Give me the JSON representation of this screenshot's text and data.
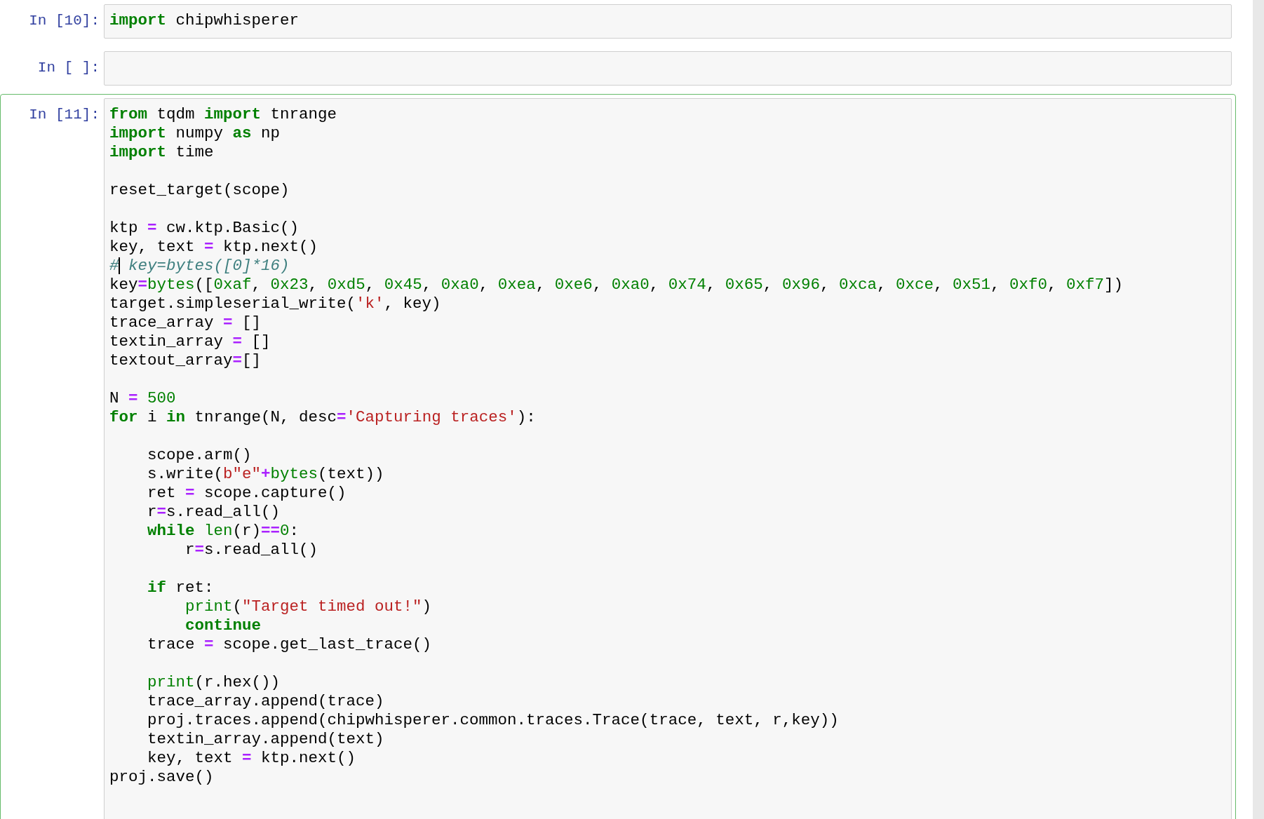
{
  "cells": [
    {
      "prompt": "In [10]:",
      "selected": false,
      "lines": [
        {
          "kind": "code",
          "tokens": [
            {
              "kind": "keyword",
              "text": "import"
            },
            {
              "kind": "plain",
              "text": " chipwhisperer"
            }
          ]
        }
      ]
    },
    {
      "prompt": "In [ ]:",
      "selected": false
    },
    {
      "prompt": "In [11]:",
      "selected": true,
      "lines": [
        {
          "kind": "code",
          "tokens": [
            {
              "kind": "keyword",
              "text": "from"
            },
            {
              "kind": "plain",
              "text": " tqdm "
            },
            {
              "kind": "keyword",
              "text": "import"
            },
            {
              "kind": "plain",
              "text": " tnrange"
            }
          ]
        },
        {
          "kind": "code",
          "tokens": [
            {
              "kind": "keyword",
              "text": "import"
            },
            {
              "kind": "plain",
              "text": " numpy "
            },
            {
              "kind": "keyword",
              "text": "as"
            },
            {
              "kind": "plain",
              "text": " np"
            }
          ]
        },
        {
          "kind": "code",
          "tokens": [
            {
              "kind": "keyword",
              "text": "import"
            },
            {
              "kind": "plain",
              "text": " time"
            }
          ]
        },
        {
          "kind": "blank"
        },
        {
          "kind": "code",
          "tokens": [
            {
              "kind": "plain",
              "text": "reset_target(scope)"
            }
          ]
        },
        {
          "kind": "blank"
        },
        {
          "kind": "code",
          "tokens": [
            {
              "kind": "plain",
              "text": "ktp "
            },
            {
              "kind": "operator",
              "text": "="
            },
            {
              "kind": "plain",
              "text": " cw.ktp.Basic()"
            }
          ]
        },
        {
          "kind": "code",
          "tokens": [
            {
              "kind": "plain",
              "text": "key, text "
            },
            {
              "kind": "operator",
              "text": "="
            },
            {
              "kind": "plain",
              "text": " ktp.next()"
            }
          ]
        },
        {
          "kind": "code",
          "tokens": [
            {
              "kind": "comment",
              "text": "#"
            },
            {
              "kind": "cursor"
            },
            {
              "kind": "comment",
              "text": " key=bytes([0]*16)"
            }
          ]
        },
        {
          "kind": "code",
          "tokens": [
            {
              "kind": "plain",
              "text": "key"
            },
            {
              "kind": "operator",
              "text": "="
            },
            {
              "kind": "builtin",
              "text": "bytes"
            },
            {
              "kind": "plain",
              "text": "(["
            },
            {
              "kind": "number",
              "text": "0xaf"
            },
            {
              "kind": "plain",
              "text": ", "
            },
            {
              "kind": "number",
              "text": "0x23"
            },
            {
              "kind": "plain",
              "text": ", "
            },
            {
              "kind": "number",
              "text": "0xd5"
            },
            {
              "kind": "plain",
              "text": ", "
            },
            {
              "kind": "number",
              "text": "0x45"
            },
            {
              "kind": "plain",
              "text": ", "
            },
            {
              "kind": "number",
              "text": "0xa0"
            },
            {
              "kind": "plain",
              "text": ", "
            },
            {
              "kind": "number",
              "text": "0xea"
            },
            {
              "kind": "plain",
              "text": ", "
            },
            {
              "kind": "number",
              "text": "0xe6"
            },
            {
              "kind": "plain",
              "text": ", "
            },
            {
              "kind": "number",
              "text": "0xa0"
            },
            {
              "kind": "plain",
              "text": ", "
            },
            {
              "kind": "number",
              "text": "0x74"
            },
            {
              "kind": "plain",
              "text": ", "
            },
            {
              "kind": "number",
              "text": "0x65"
            },
            {
              "kind": "plain",
              "text": ", "
            },
            {
              "kind": "number",
              "text": "0x96"
            },
            {
              "kind": "plain",
              "text": ", "
            },
            {
              "kind": "number",
              "text": "0xca"
            },
            {
              "kind": "plain",
              "text": ", "
            },
            {
              "kind": "number",
              "text": "0xce"
            },
            {
              "kind": "plain",
              "text": ", "
            },
            {
              "kind": "number",
              "text": "0x51"
            },
            {
              "kind": "plain",
              "text": ", "
            },
            {
              "kind": "number",
              "text": "0xf0"
            },
            {
              "kind": "plain",
              "text": ", "
            },
            {
              "kind": "number",
              "text": "0xf7"
            },
            {
              "kind": "plain",
              "text": "])"
            }
          ]
        },
        {
          "kind": "code",
          "tokens": [
            {
              "kind": "plain",
              "text": "target.simpleserial_write("
            },
            {
              "kind": "string",
              "text": "'k'"
            },
            {
              "kind": "plain",
              "text": ", key)"
            }
          ]
        },
        {
          "kind": "code",
          "tokens": [
            {
              "kind": "plain",
              "text": "trace_array "
            },
            {
              "kind": "operator",
              "text": "="
            },
            {
              "kind": "plain",
              "text": " []"
            }
          ]
        },
        {
          "kind": "code",
          "tokens": [
            {
              "kind": "plain",
              "text": "textin_array "
            },
            {
              "kind": "operator",
              "text": "="
            },
            {
              "kind": "plain",
              "text": " []"
            }
          ]
        },
        {
          "kind": "code",
          "tokens": [
            {
              "kind": "plain",
              "text": "textout_array"
            },
            {
              "kind": "operator",
              "text": "="
            },
            {
              "kind": "plain",
              "text": "[]"
            }
          ]
        },
        {
          "kind": "blank"
        },
        {
          "kind": "code",
          "tokens": [
            {
              "kind": "plain",
              "text": "N "
            },
            {
              "kind": "operator",
              "text": "="
            },
            {
              "kind": "number",
              "text": " 500"
            }
          ]
        },
        {
          "kind": "code",
          "tokens": [
            {
              "kind": "keyword",
              "text": "for"
            },
            {
              "kind": "plain",
              "text": " i "
            },
            {
              "kind": "keyword",
              "text": "in"
            },
            {
              "kind": "plain",
              "text": " tnrange(N, desc"
            },
            {
              "kind": "operator",
              "text": "="
            },
            {
              "kind": "string",
              "text": "'Capturing traces'"
            },
            {
              "kind": "plain",
              "text": "):"
            }
          ]
        },
        {
          "kind": "blank"
        },
        {
          "kind": "code",
          "tokens": [
            {
              "kind": "plain",
              "text": "    scope.arm()"
            }
          ]
        },
        {
          "kind": "code",
          "tokens": [
            {
              "kind": "plain",
              "text": "    s.write("
            },
            {
              "kind": "string",
              "text": "b\"e\""
            },
            {
              "kind": "operator",
              "text": "+"
            },
            {
              "kind": "builtin",
              "text": "bytes"
            },
            {
              "kind": "plain",
              "text": "(text))"
            }
          ]
        },
        {
          "kind": "code",
          "tokens": [
            {
              "kind": "plain",
              "text": "    ret "
            },
            {
              "kind": "operator",
              "text": "="
            },
            {
              "kind": "plain",
              "text": " scope.capture()"
            }
          ]
        },
        {
          "kind": "code",
          "tokens": [
            {
              "kind": "plain",
              "text": "    r"
            },
            {
              "kind": "operator",
              "text": "="
            },
            {
              "kind": "plain",
              "text": "s.read_all()"
            }
          ]
        },
        {
          "kind": "code",
          "tokens": [
            {
              "kind": "keyword",
              "text": "    while"
            },
            {
              "kind": "builtin",
              "text": " len"
            },
            {
              "kind": "plain",
              "text": "(r)"
            },
            {
              "kind": "operator",
              "text": "=="
            },
            {
              "kind": "number",
              "text": "0"
            },
            {
              "kind": "plain",
              "text": ":"
            }
          ]
        },
        {
          "kind": "code",
          "tokens": [
            {
              "kind": "plain",
              "text": "        r"
            },
            {
              "kind": "operator",
              "text": "="
            },
            {
              "kind": "plain",
              "text": "s.read_all()"
            }
          ]
        },
        {
          "kind": "blank"
        },
        {
          "kind": "code",
          "tokens": [
            {
              "kind": "keyword",
              "text": "    if"
            },
            {
              "kind": "plain",
              "text": " ret:"
            }
          ]
        },
        {
          "kind": "code",
          "tokens": [
            {
              "kind": "builtin",
              "text": "        print"
            },
            {
              "kind": "plain",
              "text": "("
            },
            {
              "kind": "string",
              "text": "\"Target timed out!\""
            },
            {
              "kind": "plain",
              "text": ")"
            }
          ]
        },
        {
          "kind": "code",
          "tokens": [
            {
              "kind": "keyword",
              "text": "        continue"
            }
          ]
        },
        {
          "kind": "code",
          "tokens": [
            {
              "kind": "plain",
              "text": "    trace "
            },
            {
              "kind": "operator",
              "text": "="
            },
            {
              "kind": "plain",
              "text": " scope.get_last_trace()"
            }
          ]
        },
        {
          "kind": "blank"
        },
        {
          "kind": "code",
          "tokens": [
            {
              "kind": "builtin",
              "text": "    print"
            },
            {
              "kind": "plain",
              "text": "(r.hex())"
            }
          ]
        },
        {
          "kind": "code",
          "tokens": [
            {
              "kind": "plain",
              "text": "    trace_array.append(trace)"
            }
          ]
        },
        {
          "kind": "code",
          "tokens": [
            {
              "kind": "plain",
              "text": "    proj.traces.append(chipwhisperer.common.traces.Trace(trace, text, r,key))"
            }
          ]
        },
        {
          "kind": "code",
          "tokens": [
            {
              "kind": "plain",
              "text": "    textin_array.append(text)"
            }
          ]
        },
        {
          "kind": "code",
          "tokens": [
            {
              "kind": "plain",
              "text": "    key, text "
            },
            {
              "kind": "operator",
              "text": "="
            },
            {
              "kind": "plain",
              "text": " ktp.next()"
            }
          ]
        },
        {
          "kind": "code",
          "tokens": [
            {
              "kind": "plain",
              "text": "proj.save()"
            }
          ]
        }
      ]
    }
  ]
}
